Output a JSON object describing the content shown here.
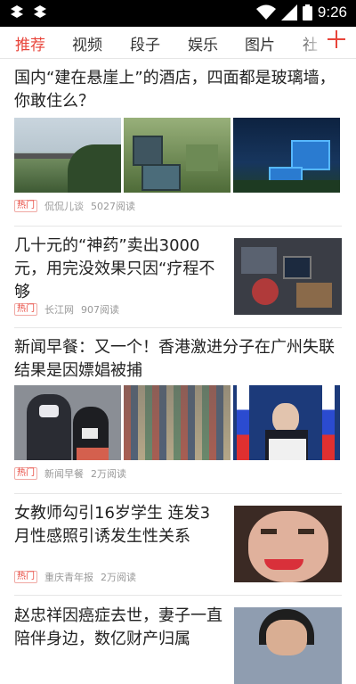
{
  "status_bar": {
    "time": "9:26",
    "icons": [
      "notification-icon",
      "notification-icon",
      "wifi-icon",
      "signal-icon",
      "battery-icon"
    ]
  },
  "tabs": {
    "items": [
      "推荐",
      "视频",
      "段子",
      "娱乐",
      "图片",
      "社"
    ],
    "active": "推荐",
    "accent": "#e8443a"
  },
  "feed": [
    {
      "title": "国内“建在悬崖上”的酒店，四面都是玻璃墙，你敢住么？",
      "badge": "热门",
      "source": "侃侃儿谈",
      "reads": "5027阅读"
    },
    {
      "title": "几十元的“神药”卖出3000元，用完没效果只因“疗程不够",
      "badge": "热门",
      "source": "长江网",
      "reads": "907阅读"
    },
    {
      "title": "新闻早餐：又一个！香港激进分子在广州失联 结果是因嫖娼被捕",
      "badge": "热门",
      "source": "新闻早餐",
      "reads": "2万阅读"
    },
    {
      "title": "女教师勾引16岁学生 连发3月性感照引诱发生性关系",
      "badge": "热门",
      "source": "重庆青年报",
      "reads": "2万阅读"
    },
    {
      "title": "赵忠祥因癌症去世，妻子一直陪伴身边，数亿财产归属"
    }
  ]
}
